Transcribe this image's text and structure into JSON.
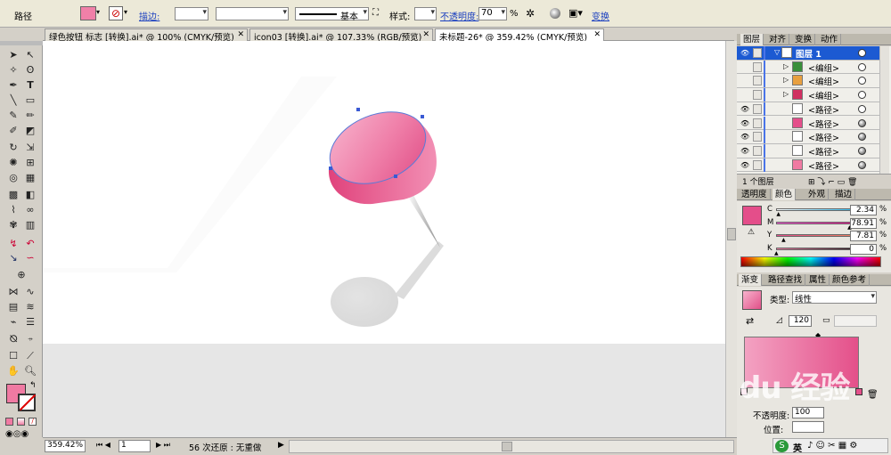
{
  "control_bar": {
    "object_type": "路径",
    "stroke_label": "描边:",
    "brush_label": "基本",
    "style_label": "样式:",
    "opacity_label": "不透明度:",
    "opacity_value": "70",
    "opacity_unit": "%",
    "transform_label": "变换",
    "fill_color": "#f080a8"
  },
  "doc_tabs": [
    {
      "label": "绿色按钮 标志 [转换].ai* @ 100% (CMYK/预览)"
    },
    {
      "label": "icon03 [转换].ai* @ 107.33% (RGB/预览)"
    },
    {
      "label": "未标题-26* @ 359.42% (CMYK/预览)"
    }
  ],
  "layers_panel": {
    "tabs": [
      "图层",
      "对齐",
      "变换",
      "动作"
    ],
    "layers": [
      {
        "name": "图层 1",
        "selected": true
      },
      {
        "name": "<编组>"
      },
      {
        "name": "<编组>"
      },
      {
        "name": "<编组>"
      },
      {
        "name": "<路径>"
      },
      {
        "name": "<路径>"
      },
      {
        "name": "<路径>"
      },
      {
        "name": "<路径>"
      },
      {
        "name": "<路径>"
      }
    ],
    "footer": "1 个图层"
  },
  "color_panel": {
    "tabs": [
      "透明度",
      "颜色",
      "外观",
      "描边"
    ],
    "channels": [
      {
        "label": "C",
        "value": "2.34",
        "unit": "%"
      },
      {
        "label": "M",
        "value": "78.91",
        "unit": "%"
      },
      {
        "label": "Y",
        "value": "7.81",
        "unit": "%"
      },
      {
        "label": "K",
        "value": "0",
        "unit": "%"
      }
    ],
    "swatch": "#e44e8a"
  },
  "gradient_panel": {
    "tabs": [
      "渐变",
      "路径查找",
      "属性",
      "颜色参考"
    ],
    "type_label": "类型:",
    "type_value": "线性",
    "angle_value": "120",
    "opacity_label": "不透明度:",
    "opacity_value": "100",
    "location_label": "位置:"
  },
  "status_bar": {
    "zoom": "359.42%",
    "page": "1",
    "undo_text": "56 次还原 : 无重做"
  },
  "watermark": "du 经验",
  "ime": {
    "label": "英"
  }
}
